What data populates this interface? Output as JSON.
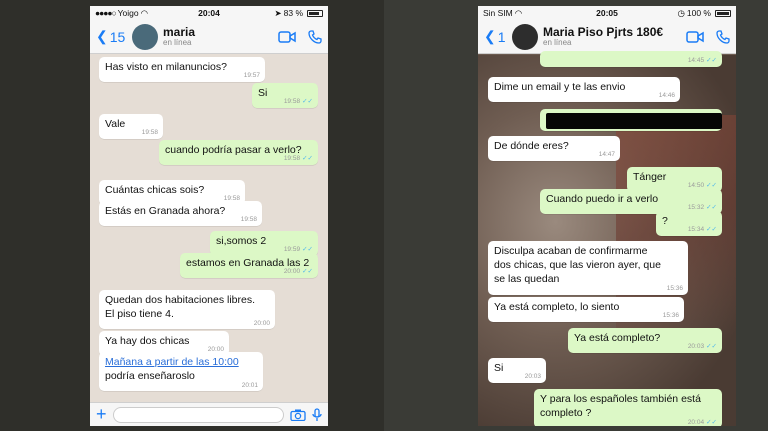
{
  "screenshot_left": {
    "status": {
      "carrier": "Yoigo",
      "time": "20:04",
      "battery": "83 %"
    },
    "header": {
      "back_count": "15",
      "name": "maria",
      "status": "en línea"
    },
    "messages": [
      {
        "dir": "in",
        "text": "Has visto en milanuncios?",
        "time": "19:57"
      },
      {
        "dir": "out",
        "text": "Si",
        "time": "19:58"
      },
      {
        "dir": "in",
        "text": "Vale",
        "time": "19:58"
      },
      {
        "dir": "out",
        "text": "cuando podría pasar a verlo?",
        "time": "19:58"
      },
      {
        "dir": "in",
        "text": "Cuántas chicas sois?",
        "time": "19:58"
      },
      {
        "dir": "in",
        "text": "Estás en Granada ahora?",
        "time": "19:58"
      },
      {
        "dir": "out",
        "text": "si,somos 2",
        "time": "19:59"
      },
      {
        "dir": "out",
        "text": "estamos en Granada las 2",
        "time": "20:00"
      },
      {
        "dir": "in",
        "text": "Quedan dos habitaciones libres.",
        "text2": "El piso tiene 4.",
        "time": "20:00"
      },
      {
        "dir": "in",
        "text": "Ya hay dos chicas",
        "time": "20:00"
      },
      {
        "dir": "in",
        "text": "Mañana a partir de las 10:00",
        "text2": "podría enseñaroslo",
        "time": "20:01"
      }
    ]
  },
  "screenshot_right": {
    "status": {
      "carrier": "Sin SIM",
      "time": "20:05",
      "battery": "100 %"
    },
    "header": {
      "back_count": "1",
      "name": "Maria Piso Pjrts 180€",
      "status": "en línea"
    },
    "messages": [
      {
        "dir": "out",
        "text": "",
        "time": "14:45"
      },
      {
        "dir": "in",
        "text": "Dime un email y te las envio",
        "time": "14:46"
      },
      {
        "dir": "out",
        "text": "",
        "time": ""
      },
      {
        "dir": "in",
        "text": "De dónde eres?",
        "time": "14:47"
      },
      {
        "dir": "out",
        "text": "Tánger",
        "time": "14:50"
      },
      {
        "dir": "out",
        "text": "Cuando puedo ir a verlo",
        "time": "15:32"
      },
      {
        "dir": "out",
        "text": "?",
        "time": "15:34"
      },
      {
        "dir": "in",
        "text": "Disculpa acaban de confirmarme",
        "text2": "dos chicas, que las vieron ayer, que",
        "text3": "se las quedan",
        "time": "15:36"
      },
      {
        "dir": "in",
        "text": "Ya está completo, lo siento",
        "time": "15:36"
      },
      {
        "dir": "out",
        "text": "Ya está completo?",
        "time": "20:03"
      },
      {
        "dir": "in",
        "text": "Si",
        "time": "20:03"
      },
      {
        "dir": "out",
        "text": "Y para los españoles también está",
        "text2": "completo ?",
        "time": "20:04"
      }
    ]
  }
}
